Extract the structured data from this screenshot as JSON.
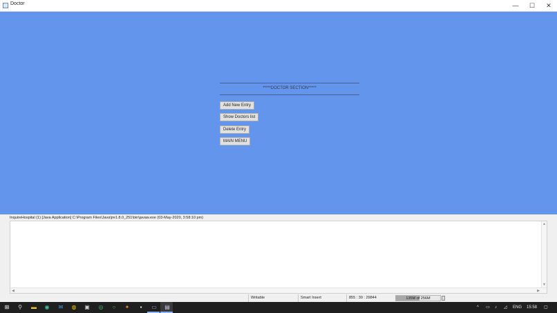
{
  "window": {
    "title": "Doctor",
    "minimize_glyph": "—",
    "maximize_glyph": "☐",
    "close_glyph": "✕"
  },
  "app": {
    "section_title": "*****DOCTOR SECTION*****",
    "buttons": {
      "add": "Add New Entry",
      "show": "Show Doctors list",
      "delete": "Delete Entry",
      "main_menu": "MAIN MENU"
    }
  },
  "console": {
    "header": "InquireHospital (1) [Java Application] C:\\Program Files\\Java\\jre1.8.0_251\\bin\\javaw.exe (03-May-2020, 3:58:10 pm)"
  },
  "statusbar": {
    "writable": "Writable",
    "insert_mode": "Smart Insert",
    "position": "855 : 39 : 29844",
    "heap": "135M of 256M",
    "heap_used_fraction": 0.53
  },
  "taskbar": {
    "icons": [
      "windows-start-icon",
      "search-icon",
      "file-explorer-icon",
      "edge-icon",
      "mail-icon",
      "chrome-icon",
      "store-icon",
      "whatsapp-icon",
      "xbox-icon",
      "sublime-icon",
      "terminal-icon",
      "video-icon",
      "eclipse-icon"
    ],
    "tray": {
      "language": "ENG",
      "time": "15:58"
    }
  },
  "colors": {
    "app_background": "#6495ed",
    "taskbar": "#1f1f1f"
  }
}
